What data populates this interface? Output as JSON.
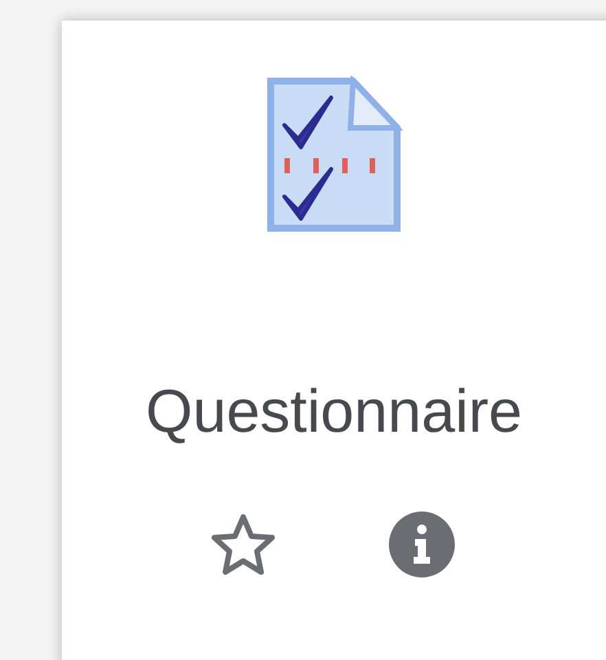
{
  "card": {
    "title": "Questionnaire",
    "starred": false
  }
}
